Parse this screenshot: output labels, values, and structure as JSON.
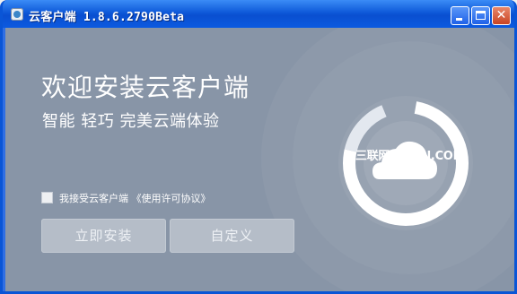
{
  "window": {
    "title": "云客户端 1.8.6.2790Beta",
    "controls": {
      "minimize_icon": "minimize-icon",
      "maximize_icon": "maximize-icon",
      "close_glyph": "✕"
    }
  },
  "installer": {
    "headline": "欢迎安装云客户端",
    "subline": "智能 轻巧 完美云端体验",
    "agreement_label": "我接受云客户端 《使用许可协议》",
    "agreement_checked": false,
    "install_button": "立即安装",
    "custom_button": "自定义",
    "watermark": "三联网 3LIAN.COM",
    "logo_icon": "cloud-ring-logo-icon"
  },
  "colors": {
    "titlebar": "#0a55d6",
    "client_background": "#8895a7",
    "button_disabled": "#b5bdc8",
    "close_button": "#c94424"
  }
}
